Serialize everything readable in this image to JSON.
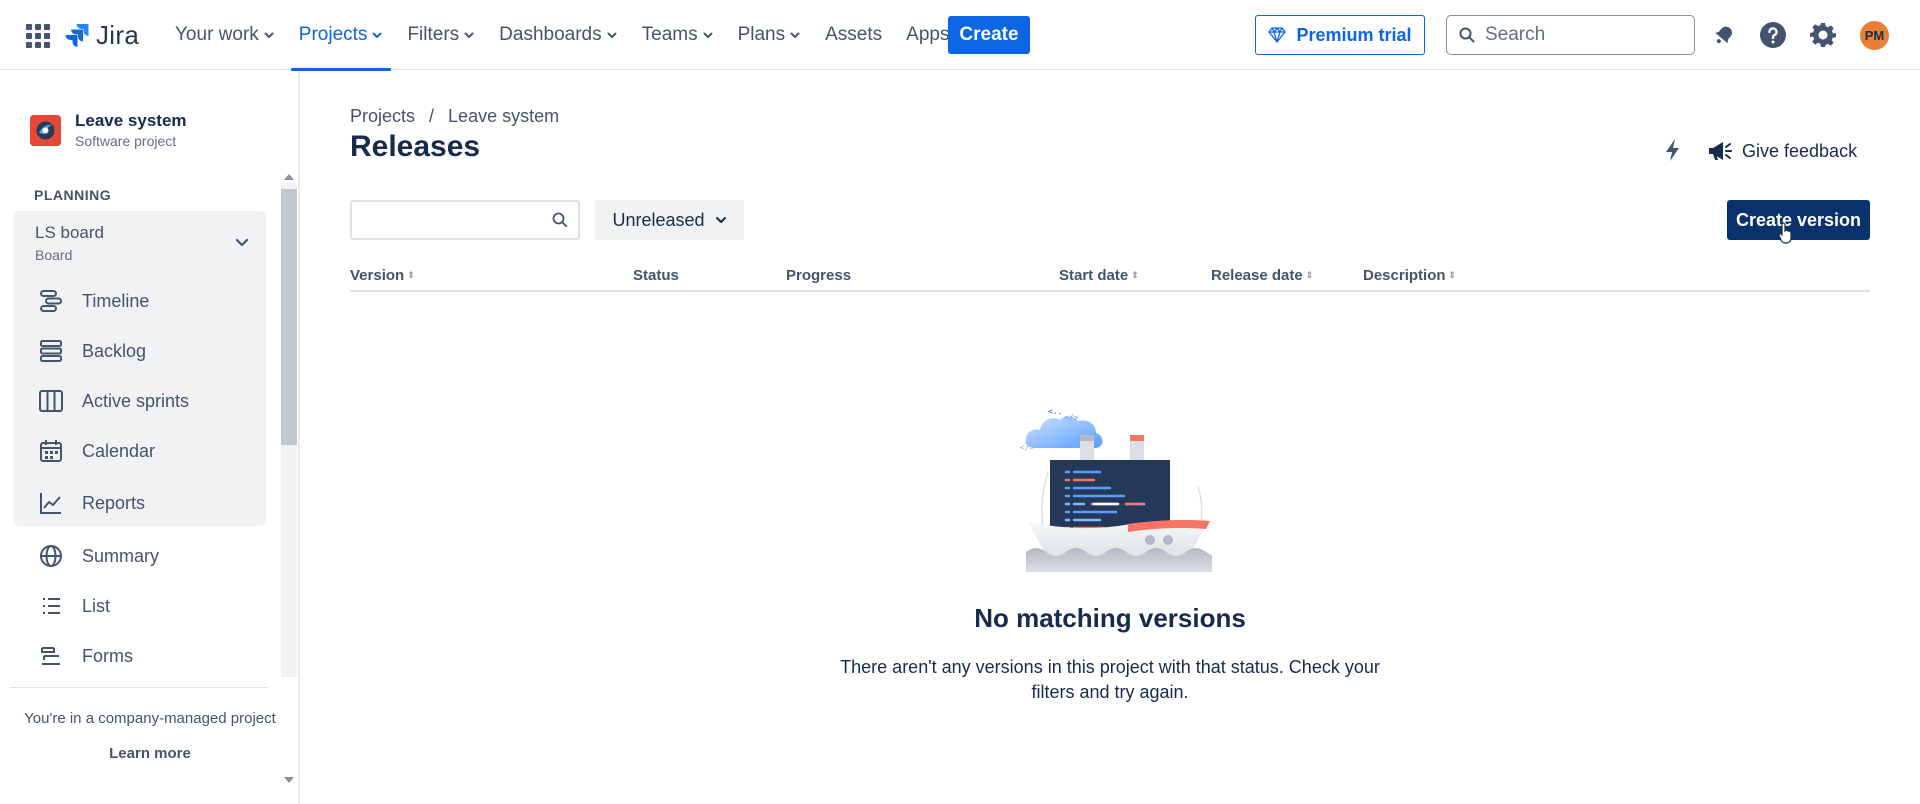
{
  "topnav": {
    "logo_text": "Jira",
    "items": [
      {
        "label": "Your work",
        "dropdown": true,
        "active": false
      },
      {
        "label": "Projects",
        "dropdown": true,
        "active": true
      },
      {
        "label": "Filters",
        "dropdown": true,
        "active": false
      },
      {
        "label": "Dashboards",
        "dropdown": true,
        "active": false
      },
      {
        "label": "Teams",
        "dropdown": true,
        "active": false
      },
      {
        "label": "Plans",
        "dropdown": true,
        "active": false
      },
      {
        "label": "Assets",
        "dropdown": false,
        "active": false
      },
      {
        "label": "Apps",
        "dropdown": true,
        "active": false
      }
    ],
    "create_label": "Create",
    "premium_label": "Premium trial",
    "search_placeholder": "Search",
    "avatar_initials": "PM",
    "accent_color": "#0c66e4"
  },
  "sidebar": {
    "project_name": "Leave system",
    "project_type": "Software project",
    "section_label": "PLANNING",
    "board": {
      "title": "LS board",
      "subtitle": "Board"
    },
    "board_items": [
      {
        "label": "Timeline",
        "icon": "timeline-icon"
      },
      {
        "label": "Backlog",
        "icon": "backlog-icon"
      },
      {
        "label": "Active sprints",
        "icon": "board-columns-icon"
      },
      {
        "label": "Calendar",
        "icon": "calendar-icon"
      },
      {
        "label": "Reports",
        "icon": "chart-line-icon"
      }
    ],
    "items": [
      {
        "label": "Summary",
        "icon": "globe-icon"
      },
      {
        "label": "List",
        "icon": "list-icon"
      },
      {
        "label": "Forms",
        "icon": "forms-icon"
      }
    ],
    "company_note": "You're in a company-managed project",
    "learn_more": "Learn more"
  },
  "main": {
    "breadcrumb": [
      "Projects",
      "Leave system"
    ],
    "breadcrumb_sep": "/",
    "title": "Releases",
    "feedback_label": "Give feedback",
    "search_value": "",
    "status_filter": "Unreleased",
    "create_version_label": "Create version",
    "columns": [
      {
        "label": "Version",
        "sortable": true
      },
      {
        "label": "Status",
        "sortable": false
      },
      {
        "label": "Progress",
        "sortable": false
      },
      {
        "label": "Start date",
        "sortable": true
      },
      {
        "label": "Release date",
        "sortable": true
      },
      {
        "label": "Description",
        "sortable": true
      }
    ],
    "empty_title": "No matching versions",
    "empty_description": "There aren't any versions in this project with that status. Check your filters and try again."
  }
}
